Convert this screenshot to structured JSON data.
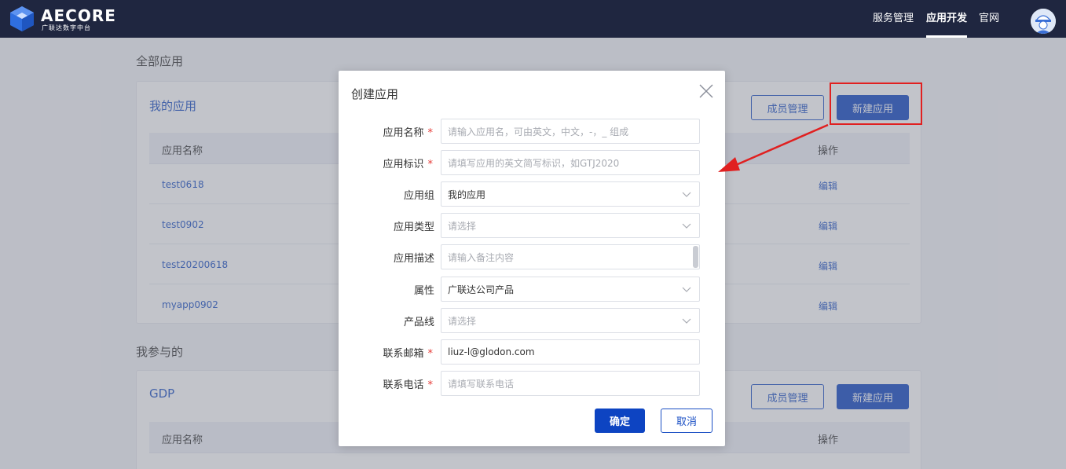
{
  "header": {
    "logo_text": "AECORE",
    "logo_sub": "广联达数字中台",
    "nav": [
      "服务管理",
      "应用开发",
      "官网"
    ],
    "active_nav": "应用开发"
  },
  "page": {
    "all_apps_title": "全部应用",
    "my_apps": {
      "title": "我的应用",
      "member_btn": "成员管理",
      "new_btn": "新建应用",
      "col_name": "应用名称",
      "col_action": "操作",
      "rows": [
        {
          "name": "test0618",
          "action": "编辑"
        },
        {
          "name": "test0902",
          "action": "编辑"
        },
        {
          "name": "test20200618",
          "action": "编辑"
        },
        {
          "name": "myapp0902",
          "action": "编辑"
        }
      ]
    },
    "participated_title": "我参与的",
    "gdp": {
      "title": "GDP",
      "member_btn": "成员管理",
      "new_btn": "新建应用",
      "col_name": "应用名称",
      "col_action": "操作"
    }
  },
  "dialog": {
    "title": "创建应用",
    "fields": [
      {
        "label": "应用名称",
        "required": true,
        "value": "",
        "placeholder": "请输入应用名，可由英文，中文，-，_ 组成"
      },
      {
        "label": "应用标识",
        "required": true,
        "value": "",
        "placeholder": "请填写应用的英文简写标识，如GTJ2020"
      },
      {
        "label": "应用组",
        "required": false,
        "value": "我的应用",
        "placeholder": ""
      },
      {
        "label": "应用类型",
        "required": false,
        "value": "",
        "placeholder": "请选择"
      },
      {
        "label": "应用描述",
        "required": false,
        "value": "",
        "placeholder": "请输入备注内容"
      },
      {
        "label": "属性",
        "required": false,
        "value": "广联达公司产品",
        "placeholder": ""
      },
      {
        "label": "产品线",
        "required": false,
        "value": "",
        "placeholder": "请选择"
      },
      {
        "label": "联系邮箱",
        "required": true,
        "value": "liuz-l@glodon.com",
        "placeholder": ""
      },
      {
        "label": "联系电话",
        "required": true,
        "value": "",
        "placeholder": "请填写联系电话"
      }
    ],
    "ok": "确定",
    "cancel": "取消"
  },
  "colors": {
    "header_bg": "#1f2640",
    "primary": "#0d44c2",
    "link": "#1a4fc4",
    "annotation": "#e02020"
  },
  "icons": [
    "logo-cube-icon",
    "avatar-icon",
    "close-icon",
    "chevron-down-icon",
    "required-asterisk-icon",
    "annotation-arrow-icon"
  ]
}
